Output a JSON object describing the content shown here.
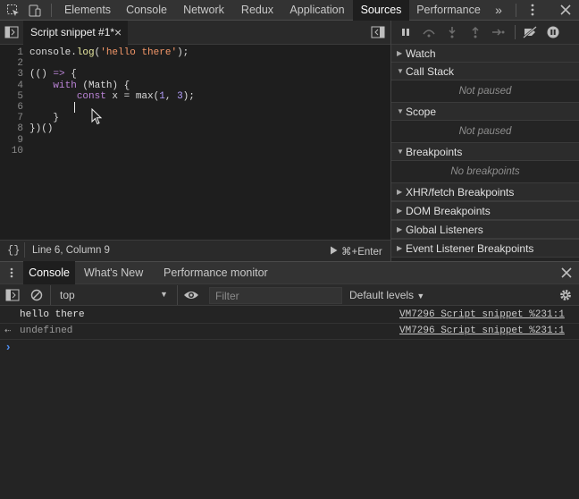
{
  "top_tabs": [
    {
      "label": "Elements"
    },
    {
      "label": "Console"
    },
    {
      "label": "Network"
    },
    {
      "label": "Redux"
    },
    {
      "label": "Application"
    },
    {
      "label": "Sources"
    },
    {
      "label": "Performance"
    }
  ],
  "top_overflow": "»",
  "sources": {
    "file_tab": "Script snippet #1*",
    "file_tab_close": "×",
    "line_numbers": [
      "1",
      "2",
      "3",
      "4",
      "5",
      "6",
      "7",
      "8",
      "9",
      "10"
    ],
    "status_position": "Line 6, Column 9",
    "status_braces": "{}",
    "run_shortcut": "⌘+Enter"
  },
  "debugger": {
    "sections": [
      {
        "label": "Watch"
      },
      {
        "label": "Call Stack"
      },
      {
        "label": "Scope"
      },
      {
        "label": "Breakpoints"
      },
      {
        "label": "XHR/fetch Breakpoints"
      },
      {
        "label": "DOM Breakpoints"
      },
      {
        "label": "Global Listeners"
      },
      {
        "label": "Event Listener Breakpoints"
      }
    ],
    "call_stack_empty": "Not paused",
    "scope_empty": "Not paused",
    "breakpoints_empty": "No breakpoints"
  },
  "drawer": {
    "tabs": [
      {
        "label": "Console"
      },
      {
        "label": "What's New"
      },
      {
        "label": "Performance monitor"
      }
    ],
    "context": "top",
    "filter_placeholder": "Filter",
    "levels": "Default levels"
  },
  "console": {
    "messages": [
      {
        "text": "hello there",
        "source": "VM7296 Script snippet %231:1"
      },
      {
        "text": "undefined",
        "source": "VM7296 Script snippet %231:1"
      }
    ],
    "prompt": "›"
  },
  "colors": {
    "accent": "#4d8df0",
    "keyword": "#bc84d8",
    "string": "#f29668",
    "number": "#b5a0ff"
  }
}
